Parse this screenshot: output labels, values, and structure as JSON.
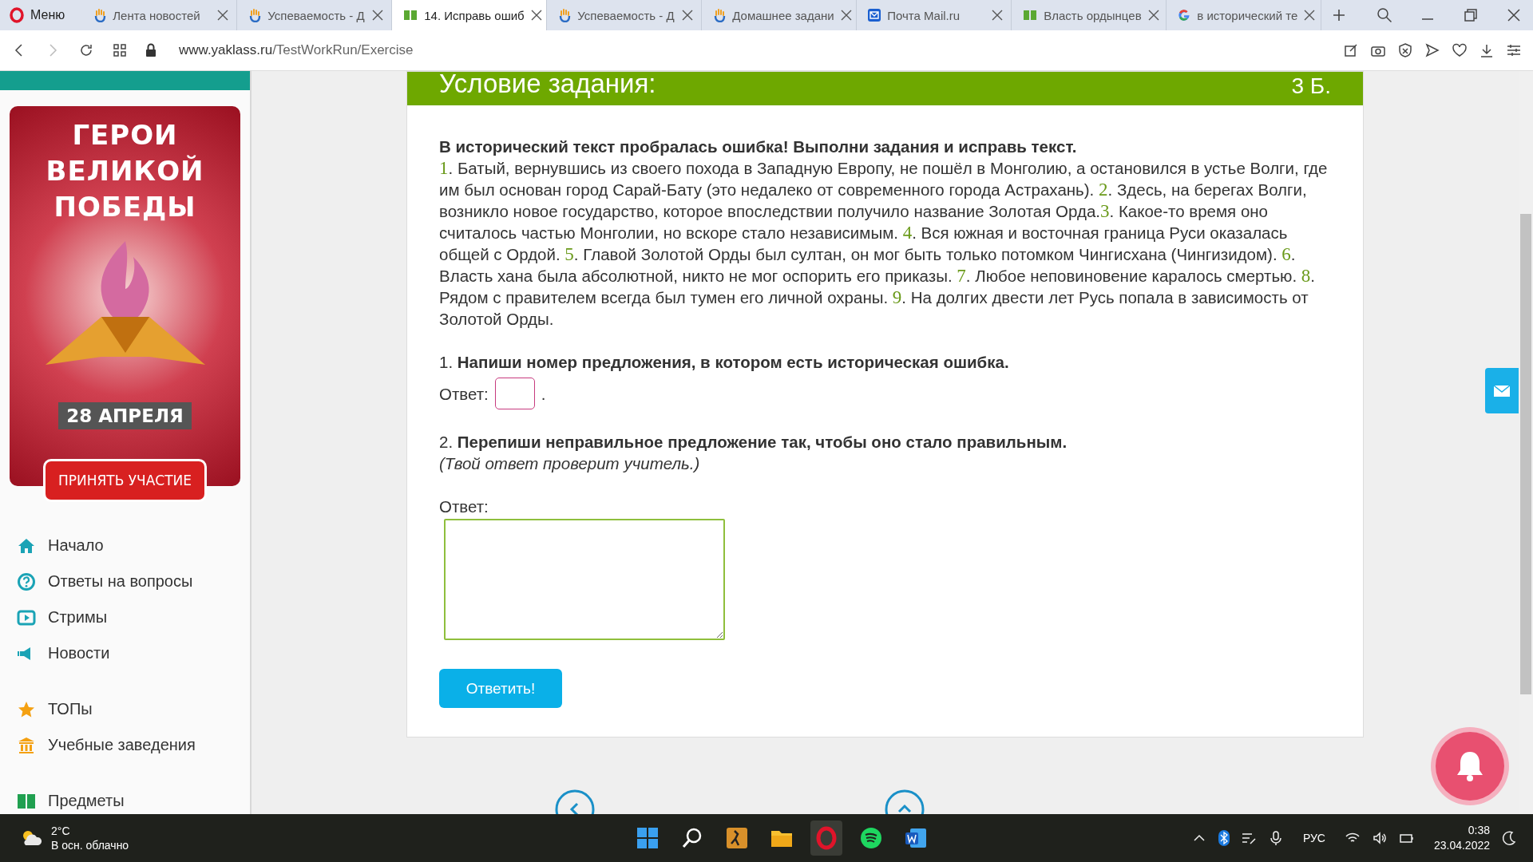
{
  "browser": {
    "menu_label": "Меню",
    "tabs": [
      {
        "kind": "yaklass",
        "title": "Лента новостей",
        "selected": false
      },
      {
        "kind": "yaklass",
        "title": "Успеваемость - Д",
        "selected": false
      },
      {
        "kind": "book",
        "title": "14. Исправь ошиб",
        "selected": true
      },
      {
        "kind": "yaklass",
        "title": "Успеваемость - Д",
        "selected": false
      },
      {
        "kind": "yaklass",
        "title": "Домашнее задани",
        "selected": false
      },
      {
        "kind": "mail",
        "title": "Почта Mail.ru",
        "selected": false
      },
      {
        "kind": "book",
        "title": "Власть ордынцев",
        "selected": false
      },
      {
        "kind": "google",
        "title": "в исторический те",
        "selected": false
      }
    ],
    "url_domain": "www.yaklass.ru",
    "url_path": "/TestWorkRun/Exercise"
  },
  "sidebar": {
    "banner": {
      "title": "ГЕРОИ ВЕЛИКОЙ ПОБЕДЫ",
      "date": "28 АПРЕЛЯ",
      "button": "ПРИНЯТЬ УЧАСТИЕ"
    },
    "groups": [
      [
        {
          "kind": "home",
          "label": "Начало"
        },
        {
          "kind": "help",
          "label": "Ответы на вопросы"
        },
        {
          "kind": "stream",
          "label": "Стримы"
        },
        {
          "kind": "news",
          "label": "Новости"
        }
      ],
      [
        {
          "kind": "top",
          "label": "ТОПы"
        },
        {
          "kind": "school",
          "label": "Учебные заведения"
        }
      ],
      [
        {
          "kind": "subjects",
          "label": "Предметы"
        }
      ]
    ]
  },
  "task": {
    "title": "Условие задания:",
    "points": "3 Б.",
    "intro": "В исторический текст пробралась ошибка! Выполни задания и исправь текст.",
    "sentences": [
      {
        "number": "1",
        "text": ". Батый, вернувшись из своего похода в Западную Европу, не пошёл в Монголию, а остановился в устье Волги, где им был основан город Сарай-Бату (это недалеко от современного города Астрахань). "
      },
      {
        "number": "2",
        "text": ". Здесь, на берегах Волги, возникло новое государство, которое впоследствии получило название Золотая Орда."
      },
      {
        "number": "3",
        "text": ". Какое-то время оно считалось частью Монголии, но вскоре стало независимым. "
      },
      {
        "number": "4",
        "text": ". Вся южная и восточная граница Руси оказалась общей с Ордой. "
      },
      {
        "number": "5",
        "text": ". Главой Золотой Орды был султан, он мог быть только потомком Чингисхана (Чингизидом). "
      },
      {
        "number": "6",
        "text": ". Власть хана была абсолютной, никто не мог оспорить его приказы. "
      },
      {
        "number": "7",
        "text": ". Любое неповиновение каралось смертью. "
      },
      {
        "number": "8",
        "text": ". Рядом с правителем всегда был тумен его личной охраны. "
      },
      {
        "number": "9",
        "text": ". На долгих двести лет Русь попала в зависимость от Золотой Орды."
      }
    ],
    "q1": {
      "number": "1.",
      "text": "Напиши номер предложения, в котором есть историческая ошибка.",
      "answer_label": "Ответ:",
      "after": "."
    },
    "q2": {
      "number": "2.",
      "text": "Перепиши неправильное предложение так, чтобы оно стало правильным.",
      "note": "(Твой ответ проверит учитель.)",
      "answer_label": "Ответ:"
    },
    "submit": "Ответить!"
  },
  "taskbar": {
    "temperature": "2°C",
    "weather": "В осн. облачно",
    "language": "РУС",
    "time": "0:38",
    "date": "23.04.2022"
  }
}
